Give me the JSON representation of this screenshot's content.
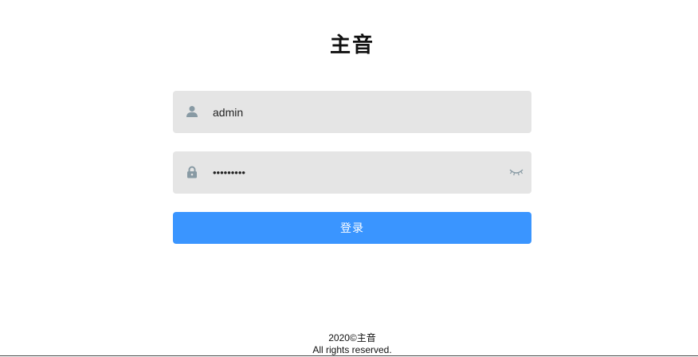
{
  "title": "主音",
  "username": {
    "value": "admin",
    "icon": "user-icon"
  },
  "password": {
    "value": "•••••••••",
    "icon": "lock-icon",
    "toggle_icon": "eye-closed-icon"
  },
  "login_button": {
    "label": "登录"
  },
  "footer": {
    "copyright": "2020©主音",
    "rights": "All rights reserved."
  },
  "colors": {
    "primary": "#3a95ff",
    "input_bg": "#e5e5e5",
    "icon": "#889aa4"
  }
}
